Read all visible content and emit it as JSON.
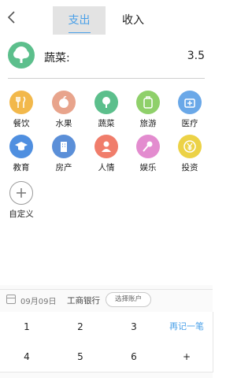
{
  "header": {
    "back_icon": "chevron-left-icon",
    "tabs": [
      {
        "label": "支出",
        "active": true
      },
      {
        "label": "收入",
        "active": false
      }
    ],
    "accent_color": "#4aa0e8"
  },
  "selected": {
    "icon": "tree-icon",
    "name": "蔬菜:",
    "amount": "3.5",
    "color": "#5cbf8c"
  },
  "categories": [
    {
      "label": "餐饮",
      "icon": "utensils-icon",
      "color": "#f2b84b"
    },
    {
      "label": "水果",
      "icon": "apple-icon",
      "color": "#e8a48c"
    },
    {
      "label": "蔬菜",
      "icon": "tree-icon",
      "color": "#5cbf8c"
    },
    {
      "label": "旅游",
      "icon": "suitcase-icon",
      "color": "#8fd06a"
    },
    {
      "label": "医疗",
      "icon": "medical-kit-icon",
      "color": "#6aa8e8"
    },
    {
      "label": "教育",
      "icon": "graduation-cap-icon",
      "color": "#4f8fe0"
    },
    {
      "label": "房产",
      "icon": "building-icon",
      "color": "#5b8fd8"
    },
    {
      "label": "人情",
      "icon": "person-icon",
      "color": "#f07d6b"
    },
    {
      "label": "娱乐",
      "icon": "microphone-icon",
      "color": "#e38ccf"
    },
    {
      "label": "投资",
      "icon": "yen-icon",
      "color": "#ecd246"
    },
    {
      "label": "自定义",
      "icon": "plus-icon",
      "color": "#ffffff"
    }
  ],
  "bar": {
    "date": "09月09日",
    "bank": "工商银行",
    "select_label": "选择账户"
  },
  "keypad": {
    "row1": [
      "1",
      "2",
      "3",
      "再记一笔"
    ],
    "row2": [
      "4",
      "5",
      "6",
      "+"
    ]
  }
}
